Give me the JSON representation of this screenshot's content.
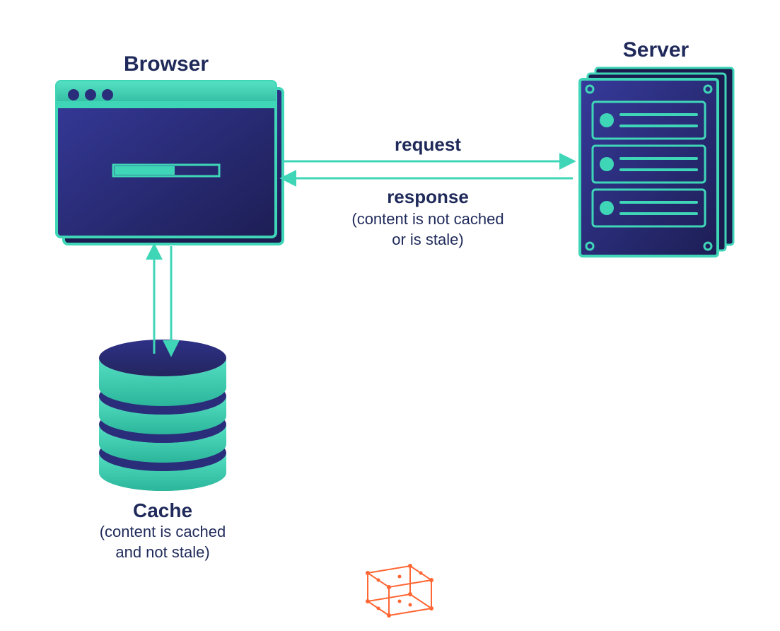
{
  "labels": {
    "browser": "Browser",
    "server": "Server",
    "cache": "Cache",
    "cache_sub": "(content is cached\nand not stale)",
    "request": "request",
    "response": "response",
    "response_sub": "(content is not cached\nor is stale)"
  },
  "colors": {
    "teal": "#3fd6b8",
    "teal_dark": "#2bb59a",
    "navy": "#2a2d7a",
    "navy_dark": "#1a1b4e",
    "text": "#1f2a5a",
    "orange": "#ff6633"
  }
}
